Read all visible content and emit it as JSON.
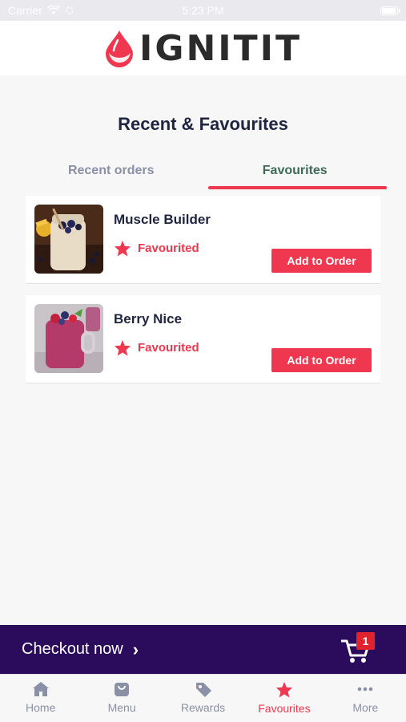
{
  "status_bar": {
    "carrier": "Carrier",
    "time": "5:23 PM",
    "battery_level": 0.95
  },
  "header": {
    "logo_text": "IGNITIT",
    "brand_color": "#ef3850"
  },
  "page": {
    "title": "Recent & Favourites"
  },
  "tabs": [
    {
      "label": "Recent orders",
      "active": false
    },
    {
      "label": "Favourites",
      "active": true
    }
  ],
  "favourites": [
    {
      "name": "Muscle Builder",
      "status": "Favourited",
      "button": "Add to Order",
      "image": "smoothie-cream-icon"
    },
    {
      "name": "Berry Nice",
      "status": "Favourited",
      "button": "Add to Order",
      "image": "smoothie-berry-icon"
    }
  ],
  "checkout": {
    "label": "Checkout now",
    "cart_count": "1",
    "background": "#2b0b5c"
  },
  "nav": [
    {
      "label": "Home",
      "icon": "home-icon",
      "active": false
    },
    {
      "label": "Menu",
      "icon": "bag-icon",
      "active": false
    },
    {
      "label": "Rewards",
      "icon": "tag-icon",
      "active": false
    },
    {
      "label": "Favourites",
      "icon": "star-icon",
      "active": true
    },
    {
      "label": "More",
      "icon": "more-icon",
      "active": false
    }
  ]
}
